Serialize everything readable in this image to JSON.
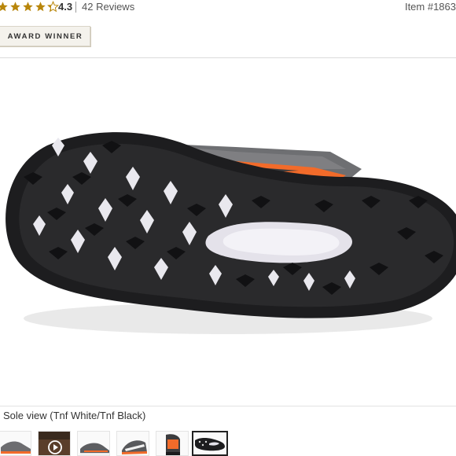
{
  "rating": {
    "value": "4.3",
    "stars_filled": 4.3,
    "stars_total": 5
  },
  "reviews": {
    "label": "42 Reviews"
  },
  "item": {
    "label": "Item #1863"
  },
  "badge": {
    "label": "AWARD WINNER"
  },
  "product_image": {
    "alt": "Sole view"
  },
  "caption": {
    "text": "Sole view (Tnf White/Tnf Black)"
  },
  "thumbnails": [
    {
      "name": "thumb-side-view"
    },
    {
      "name": "thumb-video",
      "icon": "play-icon"
    },
    {
      "name": "thumb-lateral-view"
    },
    {
      "name": "thumb-three-quarter-view"
    },
    {
      "name": "thumb-heel-view"
    },
    {
      "name": "thumb-sole-view",
      "selected": true
    }
  ],
  "colors": {
    "star": "#b8860b",
    "accent_orange": "#f26b2a",
    "sole_rubber": "#1d1d1f",
    "text": "#333333"
  }
}
